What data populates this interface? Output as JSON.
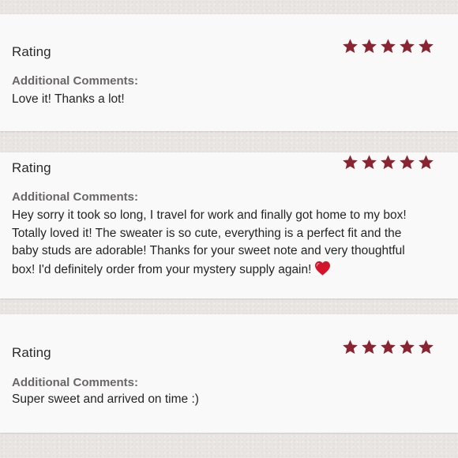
{
  "reviews": [
    {
      "rating_label": "Rating",
      "stars": 5,
      "comments_heading": "Additional Comments:",
      "comment": "Love it! Thanks a lot!"
    },
    {
      "rating_label": "Rating",
      "stars": 5,
      "comments_heading": "Additional Comments:",
      "comment_lines": [
        "Hey sorry it took so long, I travel for work and finally got home to my box!",
        "Totally loved it! The sweater is so cute, everything is a perfect fit and the",
        "baby studs are adorable! Thanks for your sweet note and very thoughtful",
        "box! I'd definitely order from your mystery supply again!"
      ],
      "emoji_icon": "red-heart-icon"
    },
    {
      "rating_label": "Rating",
      "stars": 5,
      "comments_heading": "Additional Comments:",
      "comment": "Super sweet and arrived on time :)"
    }
  ],
  "colors": {
    "star": "#8a2431",
    "heart": "#d3142b",
    "card_background": "#faf9f9",
    "page_background": "#e8e5e2"
  }
}
